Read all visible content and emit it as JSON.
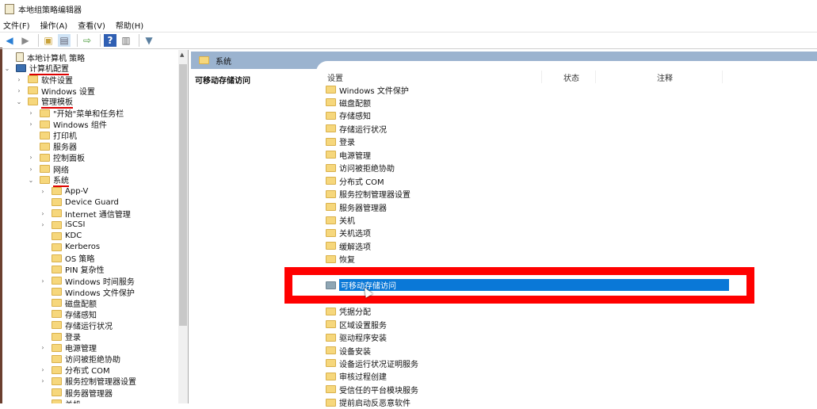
{
  "window": {
    "title": "本地组策略编辑器"
  },
  "menu": [
    "文件(F)",
    "操作(A)",
    "查看(V)",
    "帮助(H)"
  ],
  "toolbar": [
    "back-icon",
    "forward-icon",
    "up-folder-icon",
    "show-hide-tree-icon",
    "export-icon",
    "help-icon",
    "properties-icon",
    "filter-icon"
  ],
  "tree": [
    {
      "label": "本地计算机 策略",
      "level": 0,
      "arrow": "",
      "kind": "doc"
    },
    {
      "label": "计算机配置",
      "level": 0,
      "arrow": "open",
      "kind": "computer",
      "underline": true
    },
    {
      "label": "软件设置",
      "level": 1,
      "arrow": "closed"
    },
    {
      "label": "Windows 设置",
      "level": 1,
      "arrow": "closed"
    },
    {
      "label": "管理模板",
      "level": 1,
      "arrow": "open",
      "underline": true
    },
    {
      "label": "\"开始\"菜单和任务栏",
      "level": 2,
      "arrow": "closed"
    },
    {
      "label": "Windows 组件",
      "level": 2,
      "arrow": "closed"
    },
    {
      "label": "打印机",
      "level": 2,
      "arrow": ""
    },
    {
      "label": "服务器",
      "level": 2,
      "arrow": ""
    },
    {
      "label": "控制面板",
      "level": 2,
      "arrow": "closed"
    },
    {
      "label": "网络",
      "level": 2,
      "arrow": "closed"
    },
    {
      "label": "系统",
      "level": 2,
      "arrow": "open",
      "underline": true
    },
    {
      "label": "App-V",
      "level": 3,
      "arrow": "closed"
    },
    {
      "label": "Device Guard",
      "level": 3,
      "arrow": ""
    },
    {
      "label": "Internet 通信管理",
      "level": 3,
      "arrow": "closed"
    },
    {
      "label": "iSCSI",
      "level": 3,
      "arrow": "closed"
    },
    {
      "label": "KDC",
      "level": 3,
      "arrow": ""
    },
    {
      "label": "Kerberos",
      "level": 3,
      "arrow": ""
    },
    {
      "label": "OS 策略",
      "level": 3,
      "arrow": ""
    },
    {
      "label": "PIN 复杂性",
      "level": 3,
      "arrow": ""
    },
    {
      "label": "Windows 时间服务",
      "level": 3,
      "arrow": "closed"
    },
    {
      "label": "Windows 文件保护",
      "level": 3,
      "arrow": ""
    },
    {
      "label": "磁盘配额",
      "level": 3,
      "arrow": ""
    },
    {
      "label": "存储感知",
      "level": 3,
      "arrow": ""
    },
    {
      "label": "存储运行状况",
      "level": 3,
      "arrow": ""
    },
    {
      "label": "登录",
      "level": 3,
      "arrow": ""
    },
    {
      "label": "电源管理",
      "level": 3,
      "arrow": "closed"
    },
    {
      "label": "访问被拒绝协助",
      "level": 3,
      "arrow": ""
    },
    {
      "label": "分布式 COM",
      "level": 3,
      "arrow": "closed"
    },
    {
      "label": "服务控制管理器设置",
      "level": 3,
      "arrow": "closed"
    },
    {
      "label": "服务器管理器",
      "level": 3,
      "arrow": ""
    },
    {
      "label": "关机",
      "level": 3,
      "arrow": ""
    }
  ],
  "right": {
    "header": "系统",
    "description_title": "可移动存储访问",
    "columns": [
      "设置",
      "状态",
      "注释"
    ],
    "items": [
      "Windows 文件保护",
      "磁盘配额",
      "存储感知",
      "存储运行状况",
      "登录",
      "电源管理",
      "访问被拒绝协助",
      "分布式 COM",
      "服务控制管理器设置",
      "服务器管理器",
      "关机",
      "关机选项",
      "缓解选项",
      "恢复",
      "",
      "可移动存储访问",
      "",
      "凭据分配",
      "区域设置服务",
      "驱动程序安装",
      "设备安装",
      "设备运行状况证明服务",
      "审核过程创建",
      "受信任的平台模块服务",
      "提前启动反恶意软件"
    ],
    "selected": "可移动存储访问"
  },
  "colors": {
    "highlight": "#0a78d7",
    "annotation": "#ff0000",
    "header": "#9bb3cf"
  }
}
